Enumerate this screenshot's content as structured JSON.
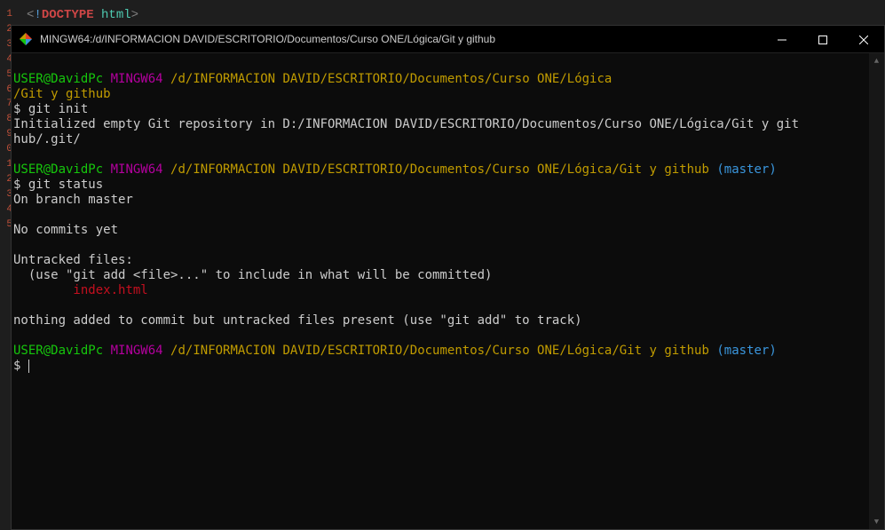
{
  "editor": {
    "line1": {
      "lt": "<",
      "excl": "!",
      "doctype": "DOCTYPE",
      "html": "html",
      "gt": ">"
    },
    "line_numbers": [
      "1",
      "2",
      "3",
      "4",
      "5",
      "6",
      "7",
      "8",
      "9",
      "0",
      "1",
      "2",
      "3",
      "4",
      "5"
    ]
  },
  "window": {
    "title": "MINGW64:/d/INFORMACION DAVID/ESCRITORIO/Documentos/Curso ONE/Lógica/Git y github"
  },
  "terminal": {
    "prompt1": {
      "user": "USER@DavidPc",
      "mingw": "MINGW64",
      "path": "/d/INFORMACION DAVID/ESCRITORIO/Documentos/Curso ONE/Lógica",
      "path2": "/Git y github"
    },
    "cmd1": "$ git init",
    "out1": "Initialized empty Git repository in D:/INFORMACION DAVID/ESCRITORIO/Documentos/Curso ONE/Lógica/Git y git\nhub/.git/",
    "prompt2": {
      "user": "USER@DavidPc",
      "mingw": "MINGW64",
      "path": "/d/INFORMACION DAVID/ESCRITORIO/Documentos/Curso ONE/Lógica/Git y github",
      "branch": "(master)"
    },
    "cmd2": "$ git status",
    "status_branch": "On branch master",
    "status_nocommits": "No commits yet",
    "untracked_header": "Untracked files:",
    "untracked_hint": "  (use \"git add <file>...\" to include in what will be committed)",
    "untracked_file": "        index.html",
    "nothing_added": "nothing added to commit but untracked files present (use \"git add\" to track)",
    "prompt3": {
      "user": "USER@DavidPc",
      "mingw": "MINGW64",
      "path": "/d/INFORMACION DAVID/ESCRITORIO/Documentos/Curso ONE/Lógica/Git y github",
      "branch": "(master)"
    },
    "cmd3": "$ "
  }
}
